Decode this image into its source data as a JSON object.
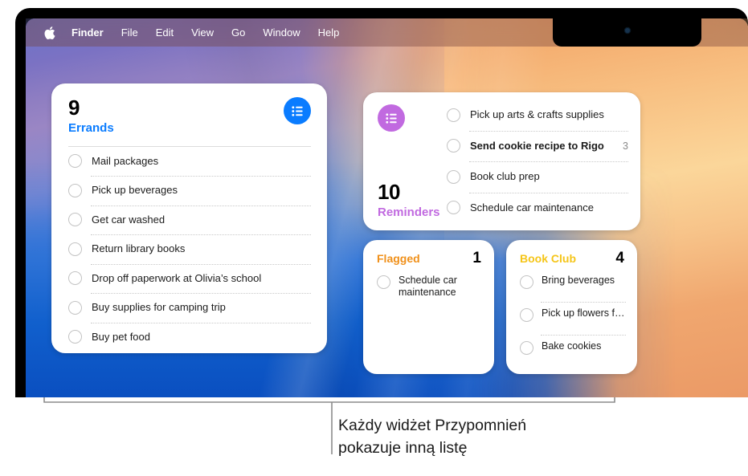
{
  "menu_bar": {
    "apple_icon": "apple-logo-icon",
    "items": [
      {
        "label": "Finder",
        "bold": true
      },
      {
        "label": "File",
        "bold": false
      },
      {
        "label": "Edit",
        "bold": false
      },
      {
        "label": "View",
        "bold": false
      },
      {
        "label": "Go",
        "bold": false
      },
      {
        "label": "Window",
        "bold": false
      },
      {
        "label": "Help",
        "bold": false
      }
    ]
  },
  "colors": {
    "blue_accent": "#0a7cff",
    "purple_accent": "#c16ae0",
    "orange_accent": "#f0901a",
    "yellow_accent": "#f5c518",
    "widget_bg": "#ffffff",
    "count_text": "#000000",
    "task_text": "#1b1b1b",
    "checkbox_border": "#c3c3c3",
    "separator": "#c9c9c9"
  },
  "widgets": {
    "errands": {
      "count": "9",
      "title": "Errands",
      "icon": "list-icon",
      "tasks": [
        {
          "text": "Mail packages",
          "bold": false,
          "badge": ""
        },
        {
          "text": "Pick up beverages",
          "bold": false,
          "badge": ""
        },
        {
          "text": "Get car washed",
          "bold": false,
          "badge": ""
        },
        {
          "text": "Return library books",
          "bold": false,
          "badge": ""
        },
        {
          "text": "Drop off paperwork at Olivia’s school",
          "bold": false,
          "badge": ""
        },
        {
          "text": "Buy supplies for camping trip",
          "bold": false,
          "badge": ""
        },
        {
          "text": "Buy pet food",
          "bold": false,
          "badge": ""
        }
      ]
    },
    "reminders": {
      "count": "10",
      "title": "Reminders",
      "icon": "list-icon",
      "tasks": [
        {
          "text": "Pick up arts & crafts supplies",
          "bold": false,
          "badge": ""
        },
        {
          "text": "Send cookie recipe to Rigo",
          "bold": true,
          "badge": "3"
        },
        {
          "text": "Book club prep",
          "bold": false,
          "badge": ""
        },
        {
          "text": "Schedule car maintenance",
          "bold": false,
          "badge": ""
        }
      ]
    },
    "flagged": {
      "title": "Flagged",
      "count": "1",
      "tasks": [
        {
          "text": "Schedule car maintenance",
          "bold": false,
          "badge": ""
        }
      ]
    },
    "book_club": {
      "title": "Book Club",
      "count": "4",
      "tasks": [
        {
          "text": "Bring beverages",
          "bold": false,
          "badge": ""
        },
        {
          "text": "Pick up flowers f…",
          "bold": false,
          "badge": ""
        },
        {
          "text": "Bake cookies",
          "bold": false,
          "badge": ""
        }
      ]
    }
  },
  "caption": {
    "line1": "Każdy widżet Przypomnień",
    "line2": "pokazuje inną listę"
  }
}
